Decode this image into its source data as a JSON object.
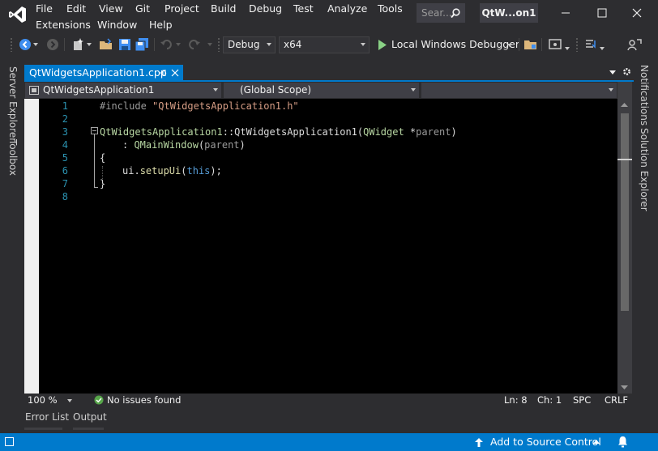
{
  "menu": {
    "row1": [
      "File",
      "Edit",
      "View",
      "Git",
      "Project",
      "Build",
      "Debug",
      "Test",
      "Analyze",
      "Tools"
    ],
    "row2": [
      "Extensions",
      "Window",
      "Help"
    ]
  },
  "search": {
    "placeholder": "Sear..."
  },
  "project_title": "QtW...on1",
  "toolbar": {
    "config": "Debug",
    "platform": "x64",
    "run_label": "Local Windows Debugger"
  },
  "side_left": [
    "Server Explorer",
    "Toolbox"
  ],
  "side_right": [
    "Notifications",
    "Solution Explorer"
  ],
  "doc_tab": {
    "label": "QtWidgetsApplication1.cpp",
    "pin": "⊣",
    "close": "✕"
  },
  "navbar": {
    "project": "QtWidgetsApplication1",
    "scope": "(Global Scope)",
    "member": ""
  },
  "code": {
    "line_numbers": [
      "1",
      "2",
      "3",
      "4",
      "5",
      "6",
      "7",
      "8"
    ],
    "l1_directive": "#include",
    "l1_string": "\"QtWidgetsApplication1.h\"",
    "l3_class": "QtWidgetsApplication1",
    "l3_sep": "::",
    "l3_fn": "QtWidgetsApplication1",
    "l3_open": "(",
    "l3_type": "QWidget",
    "l3_star": " *",
    "l3_param": "parent",
    "l3_close": ")",
    "l4_colon": ": ",
    "l4_base": "QMainWindow",
    "l4_open": "(",
    "l4_param": "parent",
    "l4_close": ")",
    "l5_brace": "{",
    "l6_obj": "ui.",
    "l6_fn": "setupUi",
    "l6_open": "(",
    "l6_kw": "this",
    "l6_close": ");",
    "l7_brace": "}"
  },
  "editor_status": {
    "zoom": "100 %",
    "issues": "No issues found",
    "line": "Ln: 8",
    "col": "Ch: 1",
    "spc": "SPC",
    "eol": "CRLF"
  },
  "bottom_tabs": [
    "Error List",
    "Output"
  ],
  "statusbar": {
    "source_control": "Add to Source Control"
  },
  "colors": {
    "accent": "#007acc",
    "background": "#2d2d30",
    "editor": "#000000"
  }
}
